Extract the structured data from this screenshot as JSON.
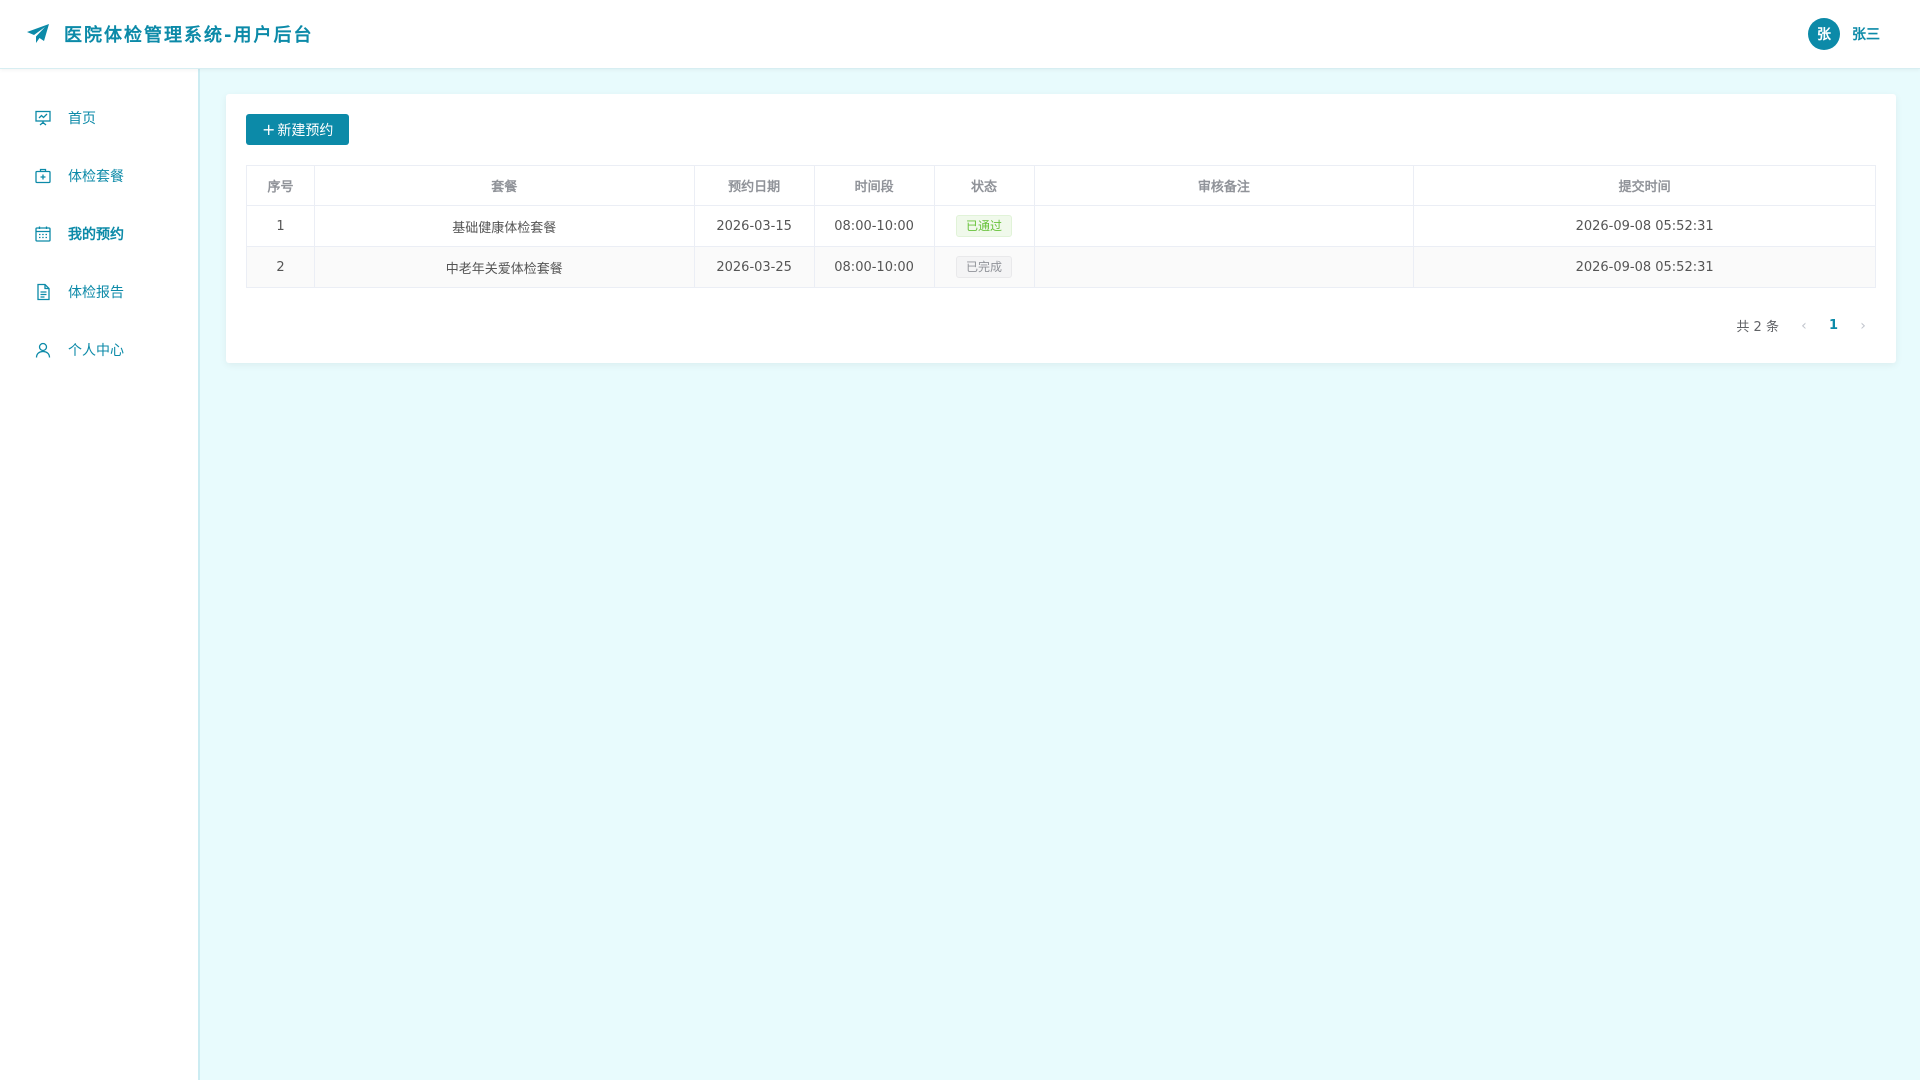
{
  "header": {
    "title": "医院体检管理系统-用户后台",
    "user_avatar_text": "张",
    "user_name": "张三"
  },
  "sidebar": {
    "items": [
      {
        "label": "首页",
        "icon": "presentation-icon"
      },
      {
        "label": "体检套餐",
        "icon": "medical-kit-icon"
      },
      {
        "label": "我的预约",
        "icon": "calendar-icon",
        "active": true
      },
      {
        "label": "体检报告",
        "icon": "document-icon"
      },
      {
        "label": "个人中心",
        "icon": "user-icon"
      }
    ]
  },
  "main": {
    "new_button": {
      "icon": "plus-icon",
      "label": "新建预约"
    },
    "table": {
      "columns": [
        "序号",
        "套餐",
        "预约日期",
        "时间段",
        "状态",
        "审核备注",
        "提交时间"
      ],
      "rows": [
        {
          "index": "1",
          "package": "基础健康体检套餐",
          "date": "2026-03-15",
          "time_slot": "08:00-10:00",
          "status": "已通过",
          "status_type": "success",
          "remark": "",
          "submitted_at": "2026-09-08 05:52:31"
        },
        {
          "index": "2",
          "package": "中老年关爱体检套餐",
          "date": "2026-03-25",
          "time_slot": "08:00-10:00",
          "status": "已完成",
          "status_type": "info",
          "remark": "",
          "submitted_at": "2026-09-08 05:52:31"
        }
      ]
    },
    "pagination": {
      "total_text": "共 2 条",
      "current_page": "1"
    }
  },
  "colors": {
    "primary": "#0c8aa8",
    "background": "#e8fbfd",
    "success": "#67c23a",
    "info": "#909399"
  }
}
